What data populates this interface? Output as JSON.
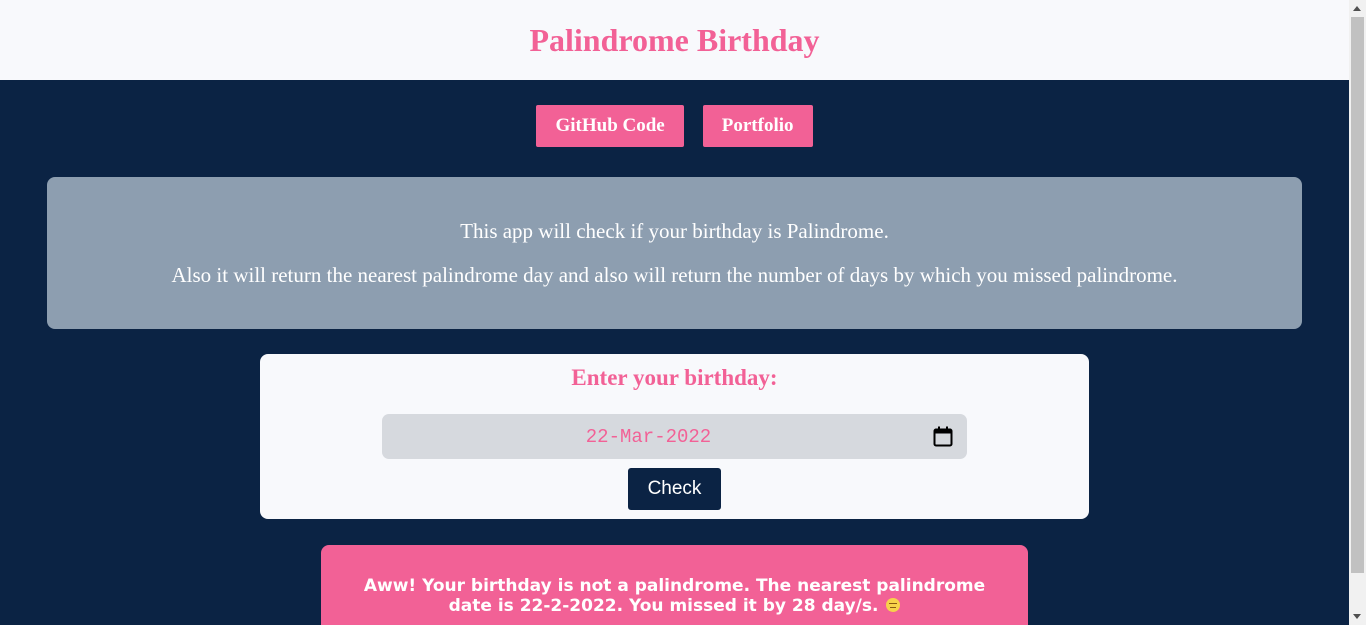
{
  "header": {
    "title": "Palindrome Birthday"
  },
  "nav": {
    "github_label": "GitHub Code",
    "portfolio_label": "Portfolio"
  },
  "info": {
    "line1": "This app will check if your birthday is Palindrome.",
    "line2": "Also it will return the nearest palindrome day and also will return the number of days by which you missed palindrome."
  },
  "form": {
    "label": "Enter your birthday:",
    "date_value": "22-Mar-2022",
    "calendar_icon": "calendar-icon",
    "check_label": "Check"
  },
  "result": {
    "message": "Aww! Your birthday is not a palindrome. The nearest palindrome date is 22-2-2022. You missed it by 28 day/s.",
    "emoji_icon": "unamused-face-emoji"
  },
  "colors": {
    "accent": "#f26196",
    "navy": "#0b2344",
    "info_bg": "#8d9eb0",
    "card_bg": "#f8f9fc"
  }
}
